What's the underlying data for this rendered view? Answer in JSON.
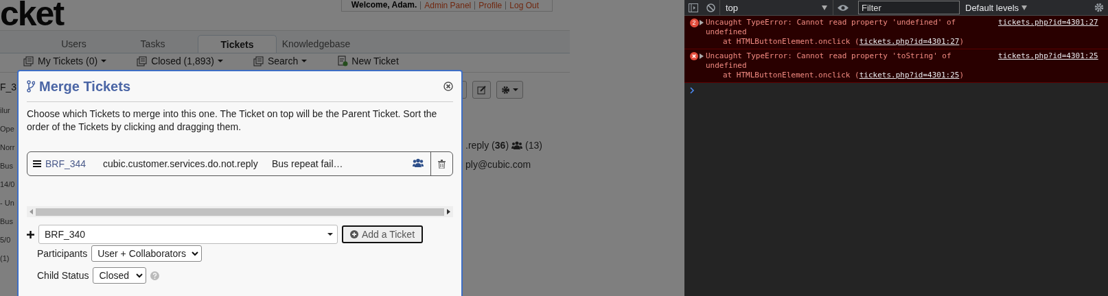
{
  "header": {
    "logo": "cket",
    "user_links": [
      {
        "text": "Welcome, Adam.",
        "kind": "text"
      },
      {
        "text": "Admin Panel",
        "kind": "link"
      },
      {
        "text": "Profile",
        "kind": "link"
      },
      {
        "text": "Log Out",
        "kind": "link"
      }
    ]
  },
  "tabs": [
    {
      "label": "Users",
      "selected": false
    },
    {
      "label": "Tasks",
      "selected": false
    },
    {
      "label": "Tickets",
      "selected": true
    },
    {
      "label": "Knowledgebase",
      "selected": false
    }
  ],
  "subnav": [
    {
      "label": "My Tickets (0)",
      "kind": "queue",
      "dropdown": true
    },
    {
      "label": "Closed (1,893)",
      "kind": "queue",
      "dropdown": true
    },
    {
      "label": "Search",
      "kind": "queue",
      "dropdown": true
    },
    {
      "label": "New Ticket",
      "kind": "new",
      "dropdown": false
    }
  ],
  "background_left": [
    "F_3",
    "ilur",
    "Ope",
    "Norr",
    "Bus",
    "14/0",
    "- Un",
    "Bus",
    "5/0",
    "(1)"
  ],
  "background_right": {
    "thread_count": ".reply (**36**)",
    "collaborators": "(13)",
    "email": "ply@cubic.com"
  },
  "modal": {
    "title": "Merge Tickets",
    "description": "Choose which Tickets to merge into this one. The Ticket on top will be the Parent Ticket. Sort the order of the Tickets by clicking and dragging them.",
    "tickets": [
      {
        "number": "BRF_344",
        "from": "cubic.customer.services.do.not.reply",
        "subject": "Bus repeat fail…"
      }
    ],
    "add": {
      "value": "BRF_340",
      "button": "Add a Ticket"
    },
    "participants": {
      "label": "Participants",
      "value": "User + Collaborators"
    },
    "child_status": {
      "label": "Child Status",
      "value": "Closed"
    }
  },
  "devtools": {
    "context": "top",
    "filter_placeholder": "Filter",
    "levels": "Default levels",
    "messages": [
      {
        "count": "2",
        "text": "Uncaught TypeError: Cannot read property 'undefined' of undefined",
        "location": "tickets.php?id=4301:27",
        "stack_prefix": "at HTMLButtonElement.onclick (",
        "stack_link": "tickets.php?id=4301:27",
        "stack_suffix": ")"
      },
      {
        "text": "Uncaught TypeError: Cannot read property 'toString' of undefined",
        "location": "tickets.php?id=4301:25",
        "stack_prefix": "at HTMLButtonElement.onclick (",
        "stack_link": "tickets.php?id=4301:25",
        "stack_suffix": ")"
      }
    ]
  }
}
